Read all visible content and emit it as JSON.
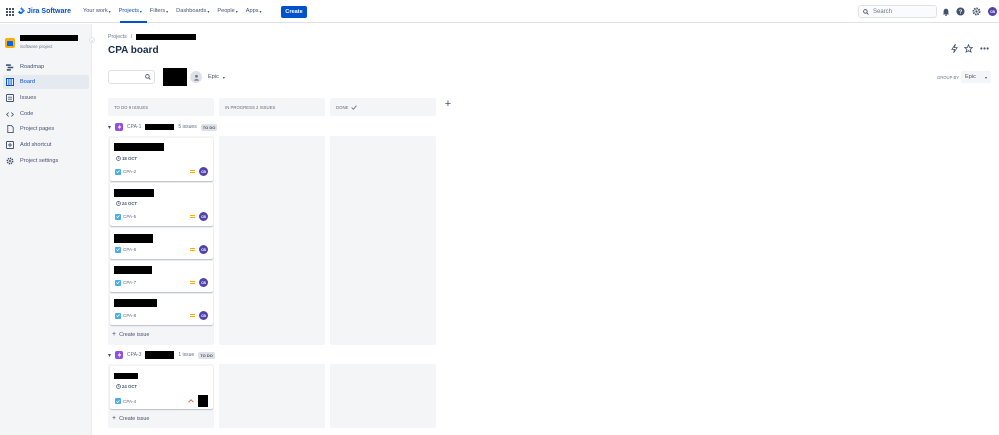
{
  "topnav": {
    "product": "Jira Software",
    "items": [
      {
        "label": "Your work",
        "active": false
      },
      {
        "label": "Projects",
        "active": true
      },
      {
        "label": "Filters",
        "active": false
      },
      {
        "label": "Dashboards",
        "active": false
      },
      {
        "label": "People",
        "active": false
      },
      {
        "label": "Apps",
        "active": false
      }
    ],
    "create_label": "Create",
    "search_placeholder": "Search",
    "user_initials": "CB"
  },
  "sidebar": {
    "project_type": "Software project",
    "items": [
      {
        "label": "Roadmap",
        "icon": "roadmap-icon",
        "active": false
      },
      {
        "label": "Board",
        "icon": "board-icon",
        "active": true
      },
      {
        "label": "Issues",
        "icon": "issues-icon",
        "active": false
      },
      {
        "label": "Code",
        "icon": "code-icon",
        "active": false
      },
      {
        "label": "Project pages",
        "icon": "pages-icon",
        "active": false
      },
      {
        "label": "Add shortcut",
        "icon": "shortcut-icon",
        "active": false
      },
      {
        "label": "Project settings",
        "icon": "settings-icon",
        "active": false
      }
    ]
  },
  "breadcrumb": {
    "root": "Projects",
    "separator": "/"
  },
  "board": {
    "title": "CPA board",
    "epic_filter": "Epic",
    "group_by_label": "GROUP BY",
    "group_by_value": "Epic",
    "columns": [
      {
        "label": "TO DO 9 ISSUES"
      },
      {
        "label": "IN PROGRESS 2 ISSUES"
      },
      {
        "label": "DONE"
      }
    ]
  },
  "swimlanes": [
    {
      "key": "CPA-1",
      "count": "5 issues",
      "status": "TO DO",
      "cards": [
        {
          "key": "CPA-2",
          "due": "18 OCT",
          "avatar": "CB"
        },
        {
          "key": "CPA-5",
          "due": "24 OCT",
          "avatar": "CB"
        },
        {
          "key": "CPA-6",
          "due": "",
          "avatar": "CB"
        },
        {
          "key": "CPA-7",
          "due": "",
          "avatar": "CB"
        },
        {
          "key": "CPA-8",
          "due": "",
          "avatar": "CB"
        }
      ],
      "create_label": "Create issue"
    },
    {
      "key": "CPA-3",
      "count": "1 issue",
      "status": "TO DO",
      "cards": [
        {
          "key": "CPA-4",
          "due": "24 OCT",
          "avatar": ""
        }
      ],
      "create_label": "Create issue"
    }
  ],
  "colors": {
    "accent": "#0052cc",
    "epic": "#904ee2",
    "column_bg": "#f4f5f7",
    "priority": "#ffab00"
  }
}
